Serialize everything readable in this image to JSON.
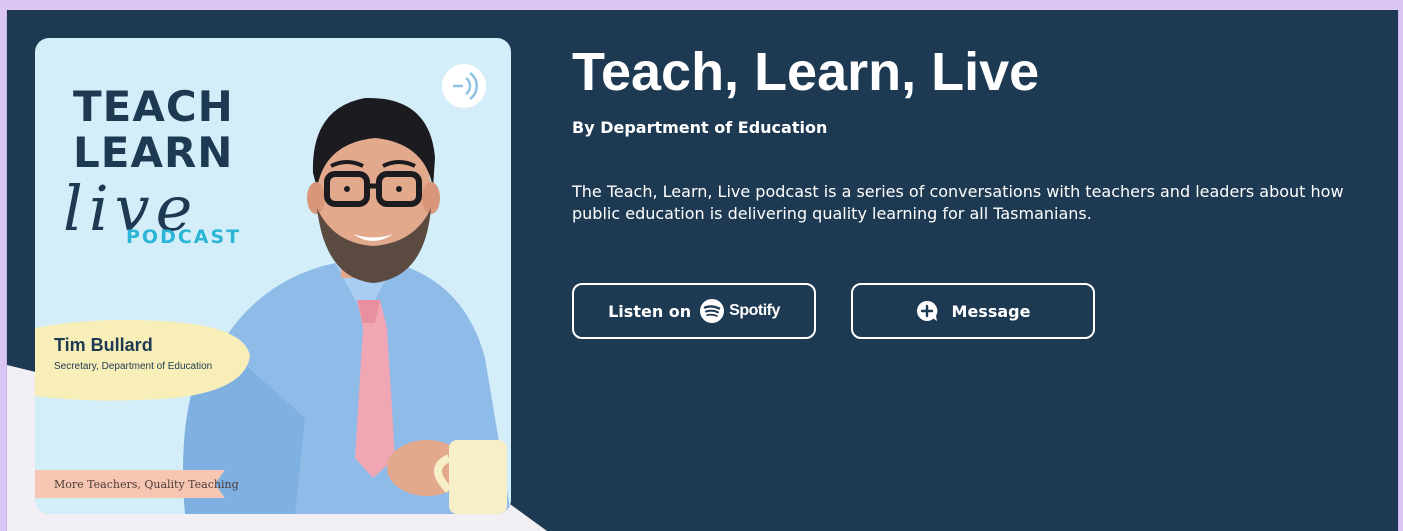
{
  "podcast": {
    "title": "Teach, Learn, Live",
    "author": "By Department of Education",
    "description": "The Teach, Learn, Live podcast is a series of conversations with teachers and leaders about how public education is delivering quality learning for all Tasmanians."
  },
  "cover": {
    "line1": "TEACH",
    "line2": "LEARN",
    "line3": "live",
    "line4": "PODCAST",
    "guest_name": "Tim Bullard",
    "guest_role": "Secretary, Department of Education",
    "tagline": "More Teachers, Quality Teaching"
  },
  "actions": {
    "listen_label": "Listen on",
    "spotify_word": "Spotify",
    "message_label": "Message"
  },
  "icons": {
    "cover_badge": "anchor-podcast-icon",
    "spotify": "spotify-icon",
    "message": "message-plus-icon"
  },
  "colors": {
    "background": "#1e3a52",
    "page_frame": "#d9c6f5",
    "cover_bg": "#d4eef9",
    "podcast_accent": "#2bb6d6"
  }
}
